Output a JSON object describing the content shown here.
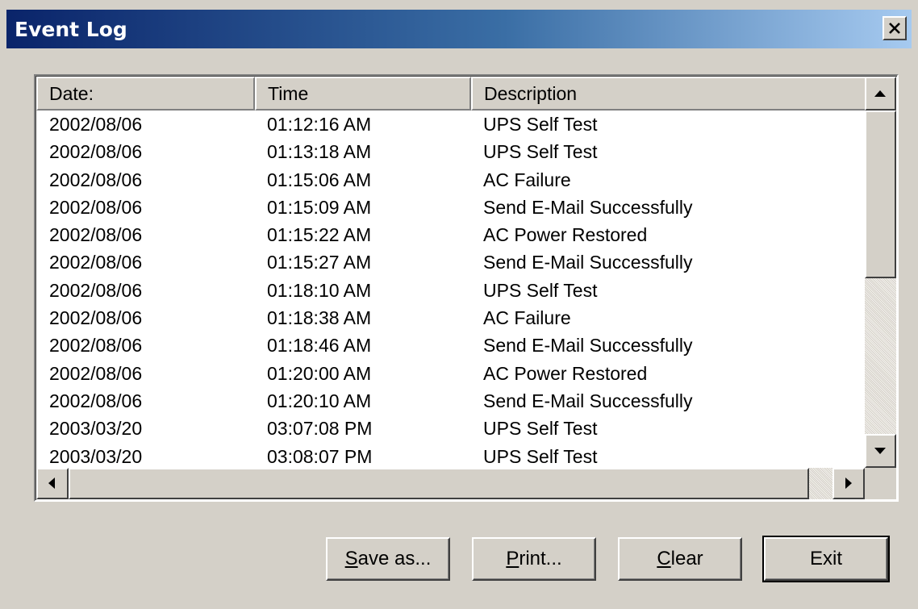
{
  "window": {
    "title": "Event Log",
    "close_icon": "close-icon"
  },
  "list": {
    "columns": [
      "Date:",
      "Time",
      "Description"
    ],
    "rows": [
      {
        "date": "2002/08/06",
        "time": "01:12:16 AM",
        "description": "UPS Self Test"
      },
      {
        "date": "2002/08/06",
        "time": "01:13:18 AM",
        "description": "UPS Self Test"
      },
      {
        "date": "2002/08/06",
        "time": "01:15:06 AM",
        "description": "AC Failure"
      },
      {
        "date": "2002/08/06",
        "time": "01:15:09 AM",
        "description": "Send E-Mail Successfully"
      },
      {
        "date": "2002/08/06",
        "time": "01:15:22 AM",
        "description": "AC Power Restored"
      },
      {
        "date": "2002/08/06",
        "time": "01:15:27 AM",
        "description": "Send E-Mail Successfully"
      },
      {
        "date": "2002/08/06",
        "time": "01:18:10 AM",
        "description": "UPS Self Test"
      },
      {
        "date": "2002/08/06",
        "time": "01:18:38 AM",
        "description": "AC Failure"
      },
      {
        "date": "2002/08/06",
        "time": "01:18:46 AM",
        "description": "Send E-Mail Successfully"
      },
      {
        "date": "2002/08/06",
        "time": "01:20:00 AM",
        "description": "AC Power Restored"
      },
      {
        "date": "2002/08/06",
        "time": "01:20:10 AM",
        "description": "Send E-Mail Successfully"
      },
      {
        "date": "2003/03/20",
        "time": "03:07:08 PM",
        "description": "UPS Self Test"
      },
      {
        "date": "2003/03/20",
        "time": "03:08:07 PM",
        "description": "UPS Self Test"
      }
    ]
  },
  "buttons": {
    "save_as": {
      "accel": "S",
      "rest": "ave as..."
    },
    "print": {
      "accel": "P",
      "rest": "rint..."
    },
    "clear": {
      "accel": "C",
      "rest": "lear"
    },
    "exit": "Exit"
  },
  "colors": {
    "titlebar_start": "#0a246a",
    "titlebar_end": "#a6caf0",
    "face": "#d4d0c8"
  }
}
